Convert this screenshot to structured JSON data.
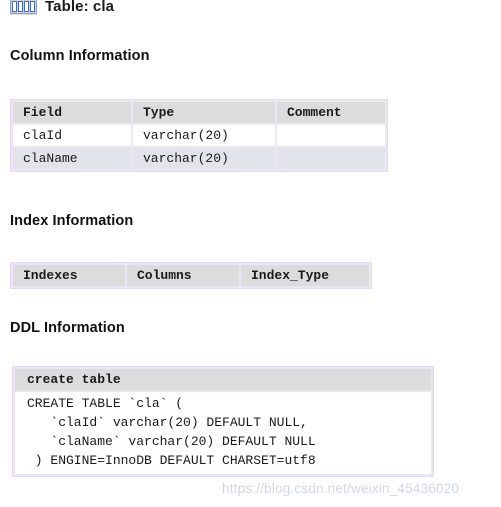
{
  "header": {
    "icon": "table-grid-icon",
    "title": "Table: cla"
  },
  "sections": {
    "column_information": {
      "heading": "Column Information",
      "columns": [
        "Field",
        "Type",
        "Comment"
      ],
      "rows": [
        [
          "claId",
          "varchar(20)",
          ""
        ],
        [
          "claName",
          "varchar(20)",
          ""
        ]
      ]
    },
    "index_information": {
      "heading": "Index Information",
      "columns": [
        "Indexes",
        "Columns",
        "Index_Type"
      ],
      "rows": []
    },
    "ddl_information": {
      "heading": "DDL Information",
      "column_header": "create table",
      "ddl": "CREATE TABLE `cla` (\n   `claId` varchar(20) DEFAULT NULL,\n   `claName` varchar(20) DEFAULT NULL\n ) ENGINE=InnoDB DEFAULT CHARSET=utf8"
    }
  },
  "watermark": {
    "text": "https://blog.csdn.net/weixin_45436020"
  },
  "colors": {
    "table_border": "#e3daf0",
    "header_cell": "#dcdcdc",
    "alt_row": "#e3e3ec",
    "text": "#1a1a1a",
    "watermark": "#c9cfe0"
  }
}
